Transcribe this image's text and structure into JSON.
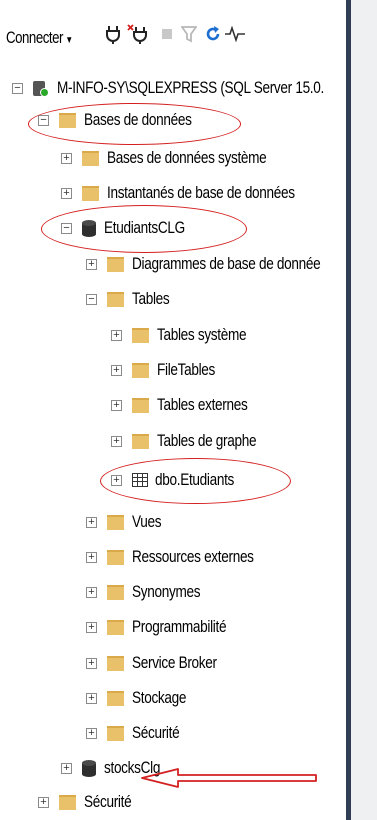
{
  "toolbar": {
    "connect_label": "Connecter",
    "icons": [
      "connect-icon",
      "disconnect-icon",
      "stop-icon",
      "filter-icon",
      "refresh-icon",
      "activity-monitor-icon"
    ]
  },
  "tree": {
    "server": "M-INFO-SY\\SQLEXPRESS (SQL Server 15.0.",
    "databases": "Bases de données",
    "system_databases": "Bases de données système",
    "snapshots": "Instantanés de base de données",
    "db_etudiants": "EtudiantsCLG",
    "diagrams": "Diagrammes de base de donnée",
    "tables": "Tables",
    "system_tables": "Tables système",
    "filetables": "FileTables",
    "external_tables": "Tables externes",
    "graph_tables": "Tables de graphe",
    "dbo_etudiants": "dbo.Etudiants",
    "views": "Vues",
    "external_resources": "Ressources externes",
    "synonyms": "Synonymes",
    "programmability": "Programmabilité",
    "service_broker": "Service Broker",
    "storage": "Stockage",
    "security_db": "Sécurité",
    "db_stocks": "stocksClg",
    "security_server": "Sécurité"
  },
  "colors": {
    "annotation": "#d42020",
    "folder": "#e8c16a",
    "divider": "#2f3d55"
  }
}
